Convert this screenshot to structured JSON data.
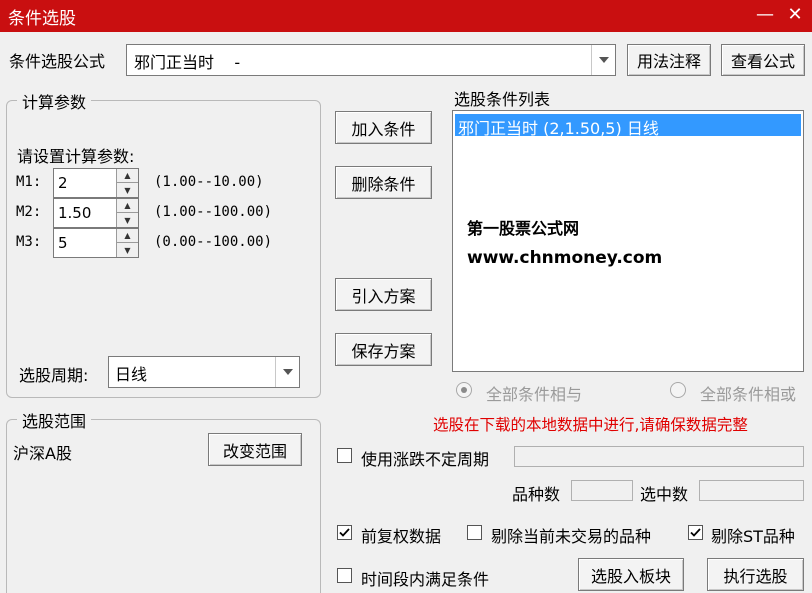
{
  "window": {
    "title": "条件选股",
    "minimize": "—",
    "close": "✕"
  },
  "formula": {
    "label": "条件选股公式",
    "value": "邪门正当时    -",
    "btn_usage": "用法注释",
    "btn_view": "查看公式"
  },
  "params": {
    "group_title": "计算参数",
    "prompt": "请设置计算参数:",
    "items": [
      {
        "label": "M1:",
        "value": "2",
        "range": "(1.00--10.00)"
      },
      {
        "label": "M2:",
        "value": "1.50",
        "range": "(1.00--100.00)"
      },
      {
        "label": "M3:",
        "value": "5",
        "range": "(0.00--100.00)"
      }
    ],
    "period_label": "选股周期:",
    "period_value": "日线"
  },
  "actions": {
    "add": "加入条件",
    "delete": "删除条件",
    "import": "引入方案",
    "save": "保存方案"
  },
  "condition_list": {
    "title": "选股条件列表",
    "items": [
      "邪门正当时 (2,1.50,5) 日线"
    ],
    "watermark_name": "第一股票公式网",
    "watermark_url": "www.chnmoney.com"
  },
  "logic": {
    "and_label": "全部条件相与",
    "or_label": "全部条件相或"
  },
  "notice": "选股在下载的本地数据中进行,请确保数据完整",
  "range": {
    "group_title": "选股范围",
    "value": "沪深A股",
    "btn_change": "改变范围"
  },
  "options": {
    "use_uncertain_period": "使用涨跌不定周期",
    "count_label": "品种数",
    "selected_label": "选中数",
    "pre_adjust": "前复权数据",
    "exclude_untraded": "剔除当前未交易的品种",
    "exclude_st": "剔除ST品种",
    "time_segment": "时间段内满足条件"
  },
  "footer": {
    "btn_to_block": "选股入板块",
    "btn_run": "执行选股"
  },
  "colors": {
    "title_bar": "#c90f10",
    "selection": "#3399ff",
    "notice": "#e00000"
  }
}
